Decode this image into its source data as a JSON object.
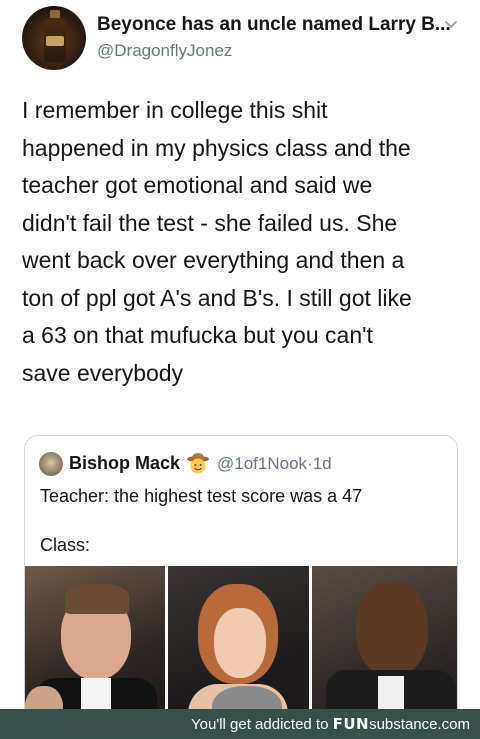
{
  "header": {
    "display_name": "Beyonce has an uncle named Larry B...",
    "handle": "@DragonflyJonez",
    "avatar_icon": "bottle-avatar",
    "menu_icon": "chevron-down-icon"
  },
  "tweet": {
    "lines": [
      "I remember in college this shit",
      "happened in my physics class and the",
      "teacher got emotional and said we",
      "didn't fail the test - she failed us. She",
      "went back over everything and then a",
      "ton of ppl got A's and B's. I still got like",
      "a 63 on that mufucka but you can't",
      "save everybody"
    ]
  },
  "quote": {
    "name": "Bishop Mack",
    "emoji_icon": "cowboy-hat-face-icon",
    "handle": "@1of1Nook",
    "separator": "·",
    "time": "1d",
    "line1": "Teacher: the highest test score was a 47",
    "line2": "Class:",
    "photos": [
      "photo-shocked-man",
      "photo-shocked-woman",
      "photo-shocked-man-2"
    ]
  },
  "footer": {
    "prefix": "You'll get addicted to",
    "brand_fun": "FUN",
    "brand_rest": "substance",
    "brand_tld": ".com"
  },
  "colors": {
    "text": "#14171a",
    "secondary": "#657786",
    "border": "#ccd6dd",
    "footer_bg": "#37504b"
  }
}
